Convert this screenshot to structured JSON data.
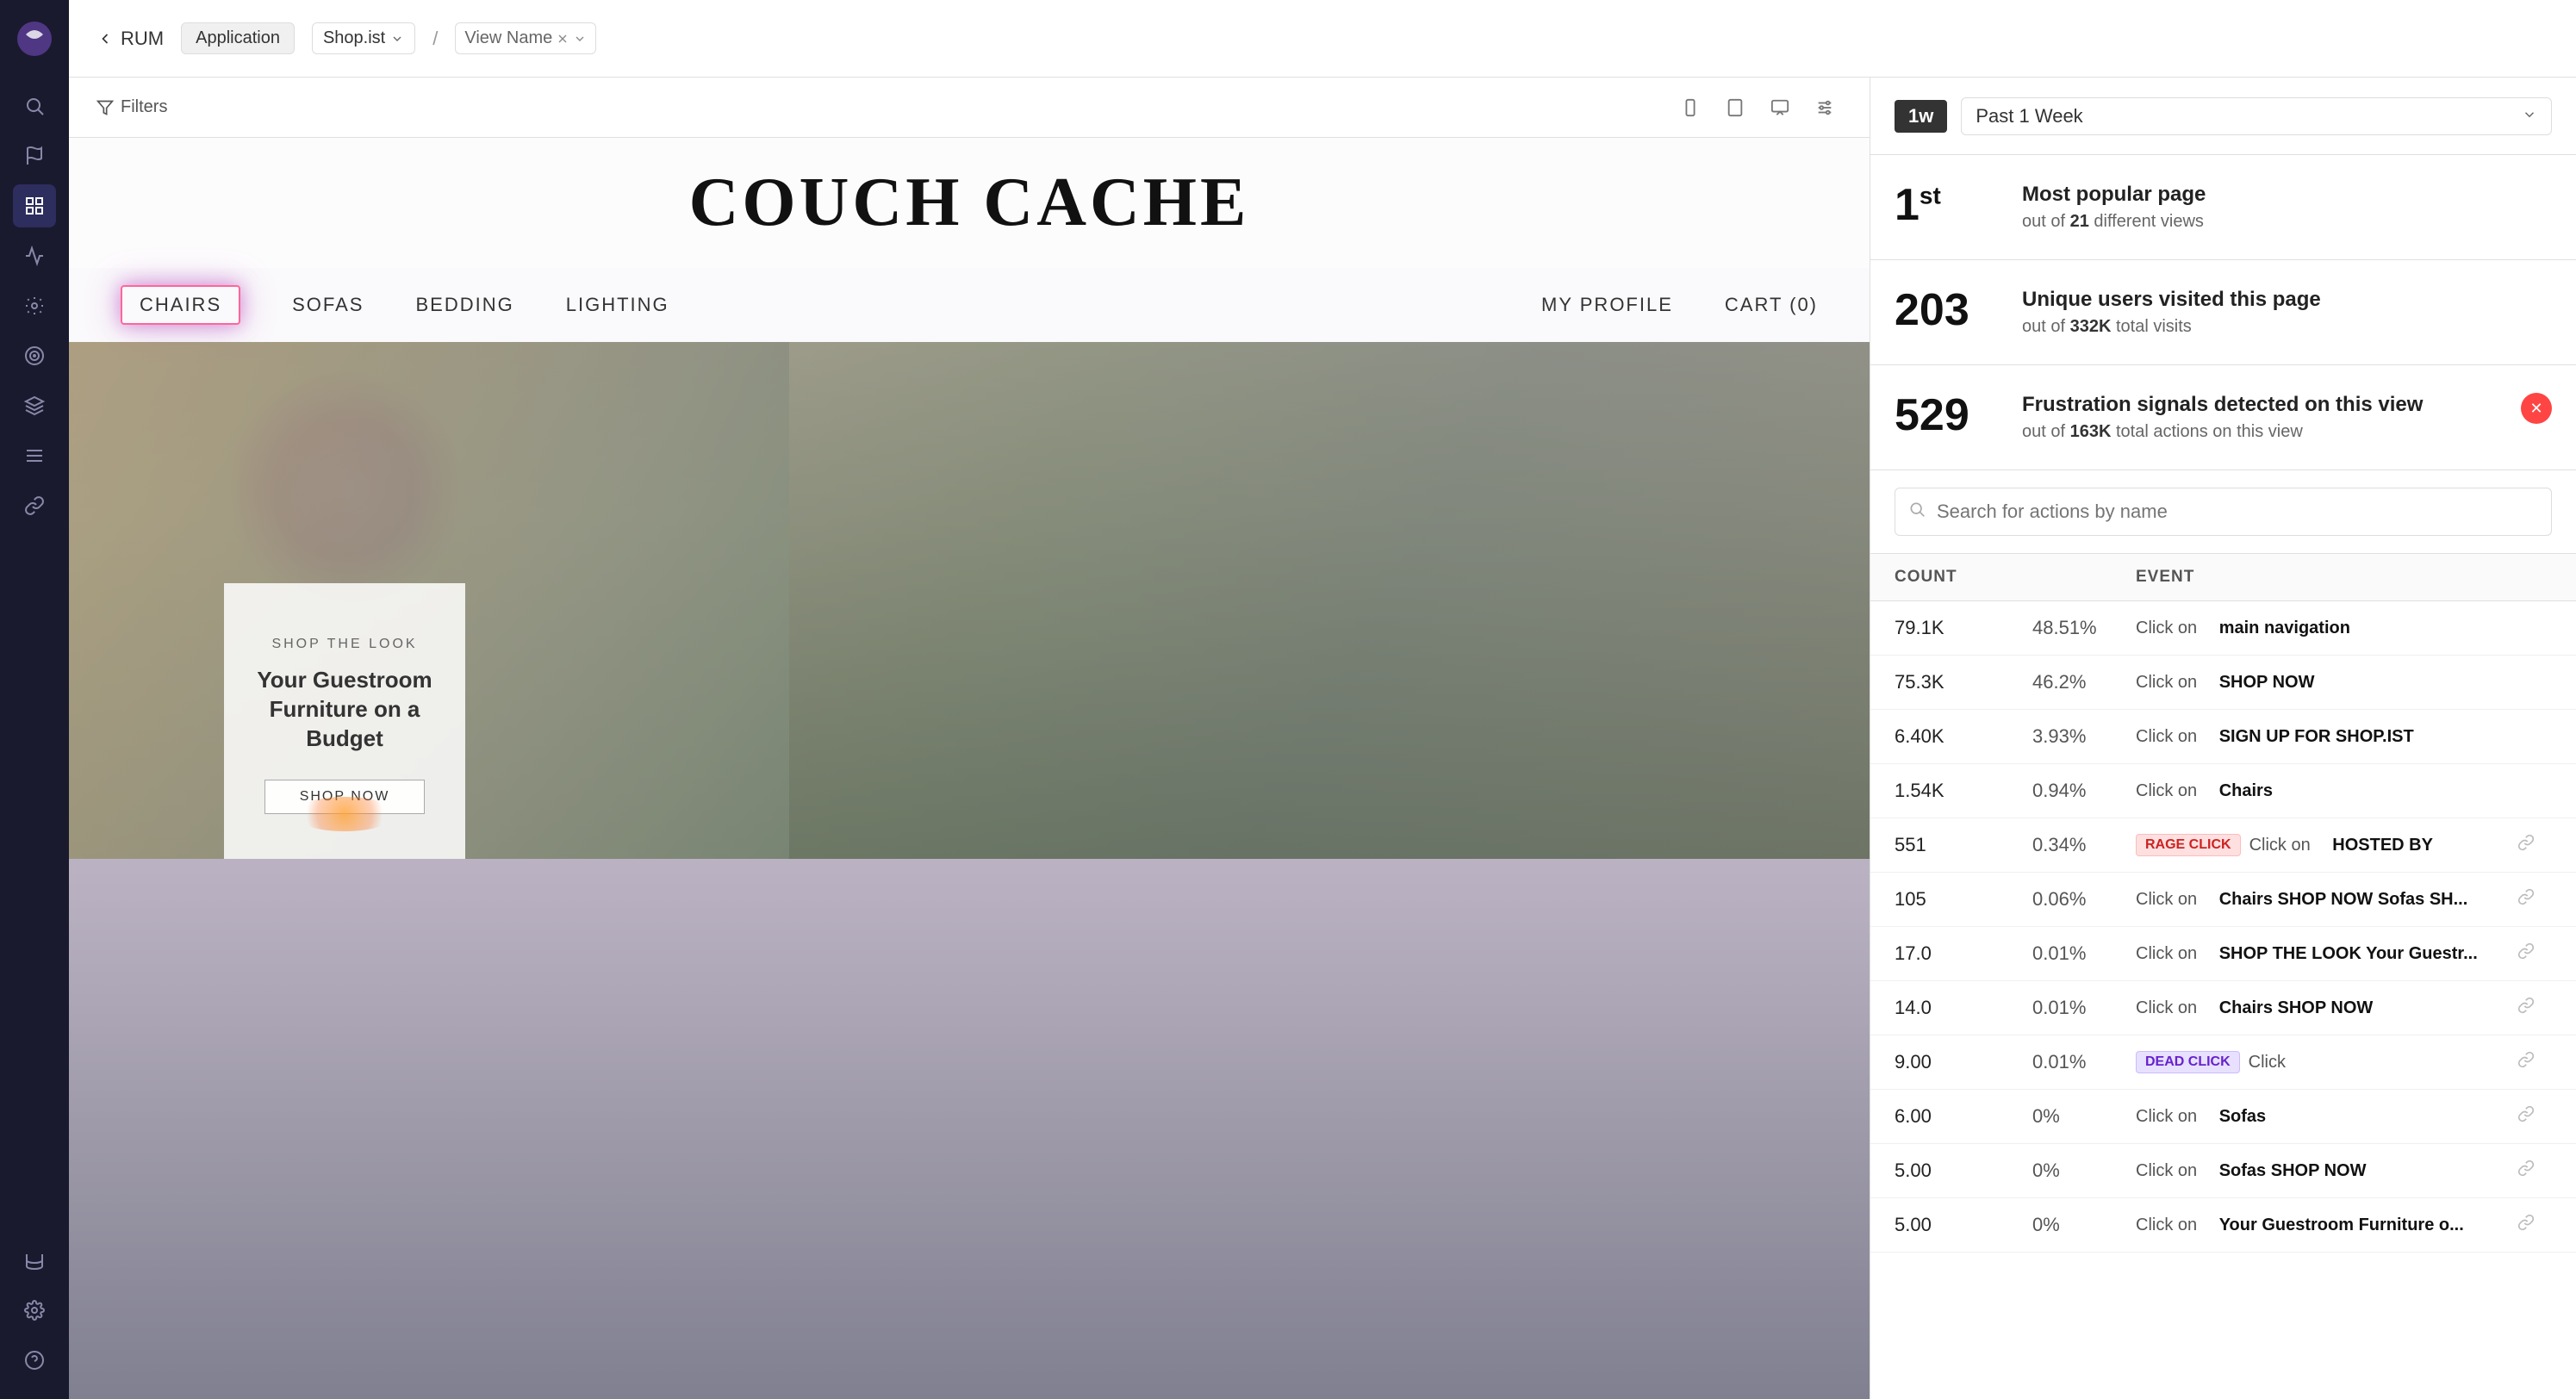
{
  "app": {
    "name": "RUM",
    "back_label": "RUM"
  },
  "topbar": {
    "breadcrumb_tag": "Application",
    "breadcrumb_dropdown": "Shop.ist",
    "breadcrumb_sep": "/",
    "breadcrumb_view": "View Name",
    "view_name_placeholder": "View Name"
  },
  "filter_bar": {
    "filter_label": "Filters"
  },
  "time_filter": {
    "badge": "1w",
    "label": "Past 1 Week"
  },
  "metrics": [
    {
      "value": "1",
      "superscript": "st",
      "title": "Most popular page",
      "subtitle_prefix": "out of ",
      "subtitle_bold": "21",
      "subtitle_suffix": " different views"
    },
    {
      "value": "203",
      "superscript": "",
      "title": "Unique users visited this page",
      "subtitle_prefix": "out of ",
      "subtitle_bold": "332K",
      "subtitle_suffix": " total visits"
    },
    {
      "value": "529",
      "superscript": "",
      "title": "Frustration signals detected on this view",
      "subtitle_prefix": "out of ",
      "subtitle_bold": "163K",
      "subtitle_suffix": " total actions on this view",
      "has_close": true
    }
  ],
  "search": {
    "placeholder": "Search for actions by name"
  },
  "events_table": {
    "headers": [
      "COUNT",
      "EVENT"
    ],
    "rows": [
      {
        "count": "79.1K",
        "pct": "48.51%",
        "badge": "",
        "desc_action": "Click on",
        "desc_target": "main navigation",
        "has_link": false
      },
      {
        "count": "75.3K",
        "pct": "46.2%",
        "badge": "",
        "desc_action": "Click on",
        "desc_target": "SHOP NOW",
        "has_link": false
      },
      {
        "count": "6.40K",
        "pct": "3.93%",
        "badge": "",
        "desc_action": "Click on",
        "desc_target": "SIGN UP FOR SHOP.IST",
        "has_link": false
      },
      {
        "count": "1.54K",
        "pct": "0.94%",
        "badge": "",
        "desc_action": "Click on",
        "desc_target": "Chairs",
        "has_link": false
      },
      {
        "count": "551",
        "pct": "0.34%",
        "badge": "RAGE CLICK",
        "badge_type": "rage",
        "desc_action": "Click on",
        "desc_target": "HOSTED BY",
        "has_link": true
      },
      {
        "count": "105",
        "pct": "0.06%",
        "badge": "",
        "desc_action": "Click on",
        "desc_target": "Chairs SHOP NOW Sofas SH...",
        "has_link": true
      },
      {
        "count": "17.0",
        "pct": "0.01%",
        "badge": "",
        "desc_action": "Click on",
        "desc_target": "SHOP THE LOOK Your Guestr...",
        "has_link": true
      },
      {
        "count": "14.0",
        "pct": "0.01%",
        "badge": "",
        "desc_action": "Click on",
        "desc_target": "Chairs SHOP NOW",
        "has_link": true
      },
      {
        "count": "9.00",
        "pct": "0.01%",
        "badge": "DEAD CLICK",
        "badge_type": "dead",
        "desc_action": "Click",
        "desc_target": "",
        "has_link": true
      },
      {
        "count": "6.00",
        "pct": "0%",
        "badge": "",
        "desc_action": "Click on",
        "desc_target": "Sofas",
        "has_link": true
      },
      {
        "count": "5.00",
        "pct": "0%",
        "badge": "",
        "desc_action": "Click on",
        "desc_target": "Sofas SHOP NOW",
        "has_link": true
      },
      {
        "count": "5.00",
        "pct": "0%",
        "badge": "",
        "desc_action": "Click on",
        "desc_target": "Your Guestroom Furniture o...",
        "has_link": true
      }
    ]
  },
  "website": {
    "title": "COUCH CACHE",
    "nav_items": [
      "CHAIRS",
      "SOFAS",
      "BEDDING",
      "LIGHTING"
    ],
    "nav_right_items": [
      "MY PROFILE",
      "CART (0)"
    ],
    "highlighted_nav": "CHAIRS",
    "shop_look_label": "SHOP THE LOOK",
    "shop_look_title": "Your Guestroom Furniture on a Budget",
    "shop_now": "SHOP NOW"
  },
  "sidebar": {
    "icons": [
      {
        "name": "search-icon",
        "symbol": "🔍"
      },
      {
        "name": "flag-icon",
        "symbol": "⚑"
      },
      {
        "name": "list-icon",
        "symbol": "☰"
      },
      {
        "name": "chart-icon",
        "symbol": "📊"
      },
      {
        "name": "settings-group-icon",
        "symbol": "⚙"
      },
      {
        "name": "target-icon",
        "symbol": "◎"
      },
      {
        "name": "puzzle-icon",
        "symbol": "⬡"
      },
      {
        "name": "layers-icon",
        "symbol": "≡"
      },
      {
        "name": "link-icon",
        "symbol": "⚲"
      },
      {
        "name": "database-icon",
        "symbol": "⊕"
      },
      {
        "name": "gear-icon",
        "symbol": "⚙"
      },
      {
        "name": "help-icon",
        "symbol": "?"
      }
    ]
  }
}
